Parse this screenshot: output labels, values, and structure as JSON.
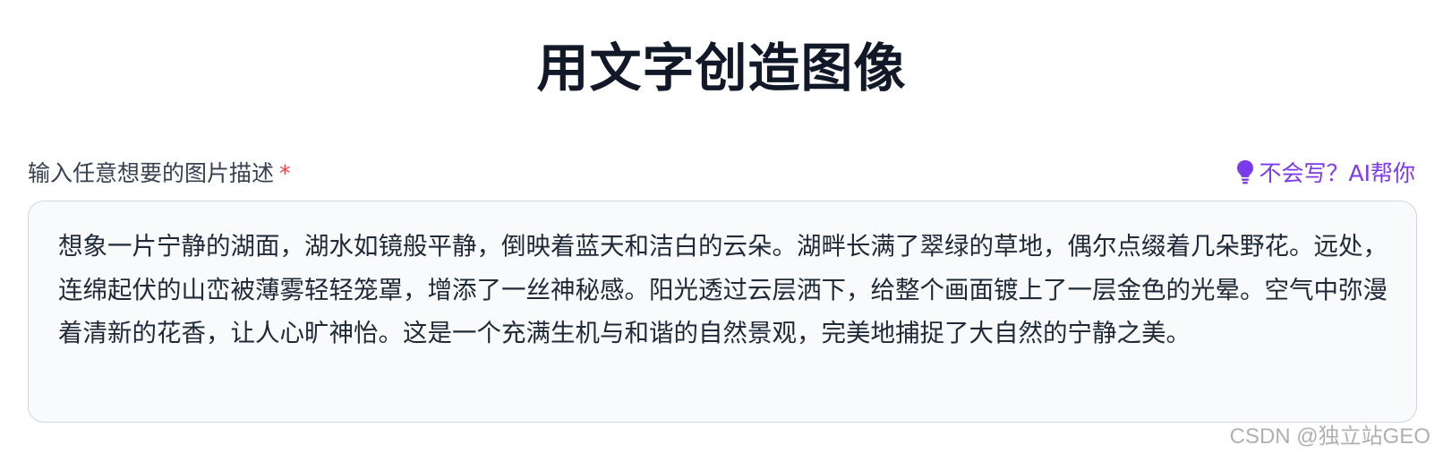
{
  "page": {
    "title": "用文字创造图像"
  },
  "form": {
    "label": "输入任意想要的图片描述",
    "required_mark": "*",
    "ai_help": {
      "icon": "lightbulb-icon",
      "label": "不会写？AI帮你",
      "color": "#7c3aed"
    },
    "prompt_value": "想象一片宁静的湖面，湖水如镜般平静，倒映着蓝天和洁白的云朵。湖畔长满了翠绿的草地，偶尔点缀着几朵野花。远处，连绵起伏的山峦被薄雾轻轻笼罩，增添了一丝神秘感。阳光透过云层洒下，给整个画面镀上了一层金色的光晕。空气中弥漫着清新的花香，让人心旷神怡。这是一个充满生机与和谐的自然景观，完美地捕捉了大自然的宁静之美。"
  },
  "watermark": "CSDN @独立站GEO"
}
